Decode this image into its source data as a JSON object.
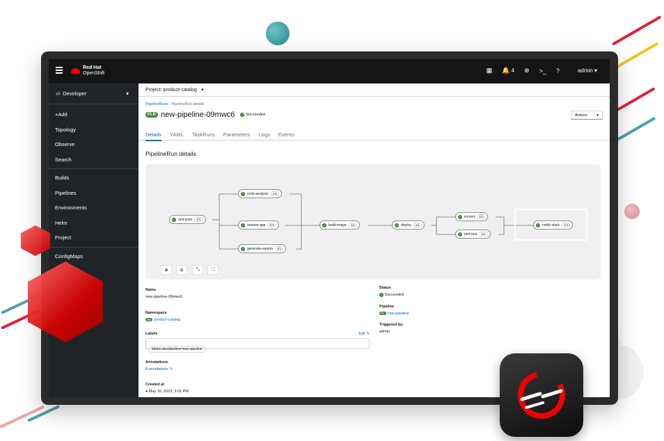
{
  "masthead": {
    "brand_top": "Red Hat",
    "brand_bottom": "OpenShift",
    "notifications_count": "4",
    "user": "admin"
  },
  "sidebar": {
    "perspective": "Developer",
    "items": [
      {
        "label": "+Add"
      },
      {
        "label": "Topology"
      },
      {
        "label": "Observe"
      },
      {
        "label": "Search"
      },
      {
        "label": "Builds"
      },
      {
        "label": "Pipelines"
      },
      {
        "label": "Environments"
      },
      {
        "label": "Helm"
      },
      {
        "label": "Project"
      },
      {
        "label": "ConfigMaps"
      }
    ]
  },
  "project": {
    "selector": "Project: product-catalog"
  },
  "breadcrumb": {
    "parent": "PipelineRuns",
    "current": "PipelineRun details"
  },
  "header": {
    "badge": "PLR",
    "title": "new-pipeline-09mwc6",
    "status": "Succeeded",
    "actions_label": "Actions"
  },
  "tabs": [
    "Details",
    "YAML",
    "TaskRuns",
    "Parameters",
    "Logs",
    "Events"
  ],
  "section_title": "PipelineRun details",
  "topology": {
    "nodes": [
      {
        "name": "unit-tests",
        "count": "1/1"
      },
      {
        "name": "code-analysis",
        "count": "1/1"
      },
      {
        "name": "release-app",
        "count": "1/1"
      },
      {
        "name": "generate-reports",
        "count": "1/1"
      },
      {
        "name": "build-image",
        "count": "1/1"
      },
      {
        "name": "deploy",
        "count": "1/1"
      },
      {
        "name": "int-test",
        "count": "1/1"
      },
      {
        "name": "perf-test",
        "count": "1/1"
      },
      {
        "name": "notify-slack",
        "count": "1/1"
      }
    ]
  },
  "details": {
    "name_label": "Name",
    "name_value": "new-pipeline-09mwc6",
    "namespace_label": "Namespace",
    "namespace_badge": "NS",
    "namespace_value": "product-catalog",
    "labels_label": "Labels",
    "labels_edit": "Edit",
    "label_chip": "tekton.dev/pipeline=new-pipeline",
    "annotations_label": "Annotations",
    "annotations_value": "8 annotations",
    "created_label": "Created at",
    "created_value": "May 16, 2023, 3:01 PM",
    "status_label": "Status",
    "status_value": "Succeeded",
    "pipeline_label": "Pipeline",
    "pipeline_badge": "PL",
    "pipeline_value": "new-pipeline",
    "triggered_label": "Triggered by:",
    "triggered_value": "admin"
  },
  "colors": {
    "masthead": "#151515",
    "sidebar": "#212427",
    "accent": "#0066cc",
    "success": "#3e8635",
    "redhat_red": "#ee0000"
  }
}
